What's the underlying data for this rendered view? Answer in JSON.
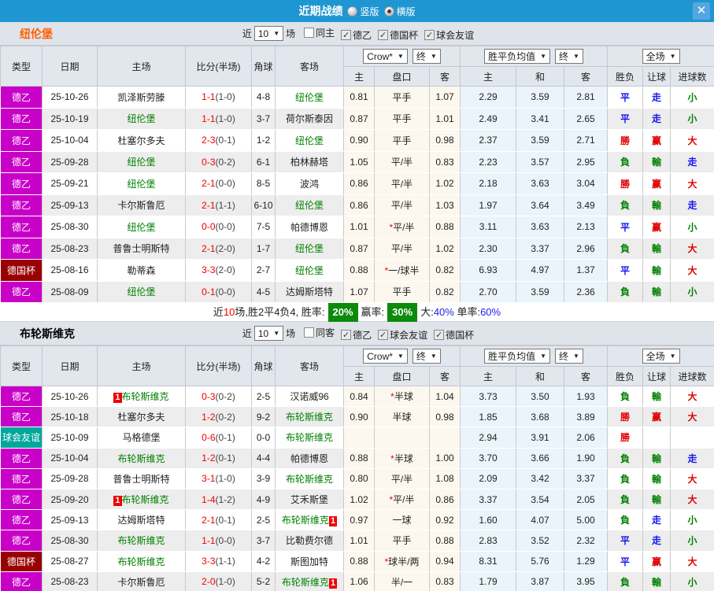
{
  "titlebar": {
    "title": "近期战绩",
    "radio_vertical": "竖版",
    "radio_horizontal": "横版",
    "close": "✕"
  },
  "table_header": {
    "type": "类型",
    "date": "日期",
    "home": "主场",
    "score": "比分(半场)",
    "corner": "角球",
    "away": "客场",
    "odds_company": "Crow*",
    "odds_final": "终",
    "avg_label": "胜平负均值",
    "avg_final": "终",
    "scope": "全场",
    "arrow": "▼",
    "sub_home": "主",
    "sub_handicap": "盘口",
    "sub_away": "客",
    "sub_avg_home": "主",
    "sub_avg_draw": "和",
    "sub_avg_away": "客",
    "sub_result": "胜负",
    "sub_let": "让球",
    "sub_goals": "进球数"
  },
  "type_colors": {
    "德乙": "#c800c8",
    "德国杯": "#990000",
    "球会友谊": "#00a79d"
  },
  "value_colors": {
    "勝": "#e00000",
    "赢": "#e00000",
    "大": "#e00000",
    "平": "#1414ee",
    "走": "#1414ee",
    "負": "#008000",
    "輸": "#008000",
    "小": "#008000"
  },
  "sections": [
    {
      "team": "纽伦堡",
      "team_color": "#ff5e00",
      "filter": {
        "near": "近",
        "count": "10",
        "games": "场",
        "checks": [
          {
            "label": "同主",
            "checked": false
          },
          {
            "label": "德乙",
            "checked": true
          },
          {
            "label": "德国杯",
            "checked": true
          },
          {
            "label": "球会友谊",
            "checked": true
          }
        ]
      },
      "rows": [
        {
          "type": "德乙",
          "date": "25-10-26",
          "home": {
            "name": "凯泽斯劳滕"
          },
          "score": "1-1",
          "half": "(1-0)",
          "corner": "4-8",
          "away": {
            "name": "纽伦堡",
            "green": true
          },
          "o1": "0.81",
          "hc": "平手",
          "o2": "1.07",
          "a1": "2.29",
          "a2": "3.59",
          "a3": "2.81",
          "r1": "平",
          "r2": "走",
          "r3": "小"
        },
        {
          "type": "德乙",
          "date": "25-10-19",
          "home": {
            "name": "纽伦堡",
            "green": true
          },
          "score": "1-1",
          "half": "(1-0)",
          "corner": "3-7",
          "away": {
            "name": "荷尔斯泰因"
          },
          "o1": "0.87",
          "hc": "平手",
          "o2": "1.01",
          "a1": "2.49",
          "a2": "3.41",
          "a3": "2.65",
          "r1": "平",
          "r2": "走",
          "r3": "小"
        },
        {
          "type": "德乙",
          "date": "25-10-04",
          "home": {
            "name": "杜塞尔多夫"
          },
          "score": "2-3",
          "half": "(0-1)",
          "corner": "1-2",
          "away": {
            "name": "纽伦堡",
            "green": true
          },
          "o1": "0.90",
          "hc": "平手",
          "o2": "0.98",
          "a1": "2.37",
          "a2": "3.59",
          "a3": "2.71",
          "r1": "勝",
          "r2": "赢",
          "r3": "大"
        },
        {
          "type": "德乙",
          "date": "25-09-28",
          "home": {
            "name": "纽伦堡",
            "green": true
          },
          "score": "0-3",
          "half": "(0-2)",
          "corner": "6-1",
          "away": {
            "name": "柏林赫塔"
          },
          "o1": "1.05",
          "hc": "平/半",
          "o2": "0.83",
          "a1": "2.23",
          "a2": "3.57",
          "a3": "2.95",
          "r1": "負",
          "r2": "輸",
          "r3": "走"
        },
        {
          "type": "德乙",
          "date": "25-09-21",
          "home": {
            "name": "纽伦堡",
            "green": true
          },
          "score": "2-1",
          "half": "(0-0)",
          "corner": "8-5",
          "away": {
            "name": "波鸿"
          },
          "o1": "0.86",
          "hc": "平/半",
          "o2": "1.02",
          "a1": "2.18",
          "a2": "3.63",
          "a3": "3.04",
          "r1": "勝",
          "r2": "赢",
          "r3": "大"
        },
        {
          "type": "德乙",
          "date": "25-09-13",
          "home": {
            "name": "卡尔斯鲁厄"
          },
          "score": "2-1",
          "half": "(1-1)",
          "corner": "6-10",
          "away": {
            "name": "纽伦堡",
            "green": true
          },
          "o1": "0.86",
          "hc": "平/半",
          "o2": "1.03",
          "a1": "1.97",
          "a2": "3.64",
          "a3": "3.49",
          "r1": "負",
          "r2": "輸",
          "r3": "走"
        },
        {
          "type": "德乙",
          "date": "25-08-30",
          "home": {
            "name": "纽伦堡",
            "green": true
          },
          "score": "0-0",
          "half": "(0-0)",
          "corner": "7-5",
          "away": {
            "name": "帕德博恩"
          },
          "o1": "1.01",
          "hc": "*平/半",
          "o2": "0.88",
          "a1": "3.11",
          "a2": "3.63",
          "a3": "2.13",
          "r1": "平",
          "r2": "赢",
          "r3": "小"
        },
        {
          "type": "德乙",
          "date": "25-08-23",
          "home": {
            "name": "普鲁士明斯特"
          },
          "score": "2-1",
          "half": "(2-0)",
          "corner": "1-7",
          "away": {
            "name": "纽伦堡",
            "green": true
          },
          "o1": "0.87",
          "hc": "平/半",
          "o2": "1.02",
          "a1": "2.30",
          "a2": "3.37",
          "a3": "2.96",
          "r1": "負",
          "r2": "輸",
          "r3": "大"
        },
        {
          "type": "德国杯",
          "date": "25-08-16",
          "home": {
            "name": "勒蒂森"
          },
          "score": "3-3",
          "half": "(2-0)",
          "corner": "2-7",
          "away": {
            "name": "纽伦堡",
            "green": true
          },
          "o1": "0.88",
          "hc": "*一/球半",
          "o2": "0.82",
          "a1": "6.93",
          "a2": "4.97",
          "a3": "1.37",
          "r1": "平",
          "r2": "輸",
          "r3": "大"
        },
        {
          "type": "德乙",
          "date": "25-08-09",
          "home": {
            "name": "纽伦堡",
            "green": true
          },
          "score": "0-1",
          "half": "(0-0)",
          "corner": "4-5",
          "away": {
            "name": "达姆斯塔特"
          },
          "o1": "1.07",
          "hc": "平手",
          "o2": "0.82",
          "a1": "2.70",
          "a2": "3.59",
          "a3": "2.36",
          "r1": "負",
          "r2": "輸",
          "r3": "小"
        }
      ],
      "summary": {
        "t1": "近",
        "count": "10",
        "t2": "场,胜2平4负4, 胜率:",
        "win_rate": "20%",
        "t3": "赢率:",
        "odds_rate": "30%",
        "t4": "大:",
        "big_rate": "40%",
        "t5": " 单率:",
        "single_rate": "60%"
      }
    },
    {
      "team": "布轮斯维克",
      "team_color": "#000000",
      "filter": {
        "near": "近",
        "count": "10",
        "games": "场",
        "checks": [
          {
            "label": "同客",
            "checked": false
          },
          {
            "label": "德乙",
            "checked": true
          },
          {
            "label": "球会友谊",
            "checked": true
          },
          {
            "label": "德国杯",
            "checked": true
          }
        ]
      },
      "rows": [
        {
          "type": "德乙",
          "date": "25-10-26",
          "home": {
            "name": "布轮斯维克",
            "green": true,
            "pre": "1"
          },
          "score": "0-3",
          "half": "(0-2)",
          "corner": "2-5",
          "away": {
            "name": "汉诺威96"
          },
          "o1": "0.84",
          "hc": "*半球",
          "o2": "1.04",
          "a1": "3.73",
          "a2": "3.50",
          "a3": "1.93",
          "r1": "負",
          "r2": "輸",
          "r3": "大"
        },
        {
          "type": "德乙",
          "date": "25-10-18",
          "home": {
            "name": "杜塞尔多夫"
          },
          "score": "1-2",
          "half": "(0-2)",
          "corner": "9-2",
          "away": {
            "name": "布轮斯维克",
            "green": true
          },
          "o1": "0.90",
          "hc": "半球",
          "o2": "0.98",
          "a1": "1.85",
          "a2": "3.68",
          "a3": "3.89",
          "r1": "勝",
          "r2": "赢",
          "r3": "大"
        },
        {
          "type": "球会友谊",
          "date": "25-10-09",
          "home": {
            "name": "马格德堡"
          },
          "score": "0-6",
          "half": "(0-1)",
          "corner": "0-0",
          "away": {
            "name": "布轮斯维克",
            "green": true
          },
          "o1": "",
          "hc": "",
          "o2": "",
          "a1": "2.94",
          "a2": "3.91",
          "a3": "2.06",
          "r1": "勝",
          "r2": "",
          "r3": ""
        },
        {
          "type": "德乙",
          "date": "25-10-04",
          "home": {
            "name": "布轮斯维克",
            "green": true
          },
          "score": "1-2",
          "half": "(0-1)",
          "corner": "4-4",
          "away": {
            "name": "帕德博恩"
          },
          "o1": "0.88",
          "hc": "*半球",
          "o2": "1.00",
          "a1": "3.70",
          "a2": "3.66",
          "a3": "1.90",
          "r1": "負",
          "r2": "輸",
          "r3": "走"
        },
        {
          "type": "德乙",
          "date": "25-09-28",
          "home": {
            "name": "普鲁士明斯特"
          },
          "score": "3-1",
          "half": "(1-0)",
          "corner": "3-9",
          "away": {
            "name": "布轮斯维克",
            "green": true
          },
          "o1": "0.80",
          "hc": "平/半",
          "o2": "1.08",
          "a1": "2.09",
          "a2": "3.42",
          "a3": "3.37",
          "r1": "負",
          "r2": "輸",
          "r3": "大"
        },
        {
          "type": "德乙",
          "date": "25-09-20",
          "home": {
            "name": "布轮斯维克",
            "green": true,
            "pre": "1"
          },
          "score": "1-4",
          "half": "(1-2)",
          "corner": "4-9",
          "away": {
            "name": "艾禾斯堡"
          },
          "o1": "1.02",
          "hc": "*平/半",
          "o2": "0.86",
          "a1": "3.37",
          "a2": "3.54",
          "a3": "2.05",
          "r1": "負",
          "r2": "輸",
          "r3": "大"
        },
        {
          "type": "德乙",
          "date": "25-09-13",
          "home": {
            "name": "达姆斯塔特"
          },
          "score": "2-1",
          "half": "(0-1)",
          "corner": "2-5",
          "away": {
            "name": "布轮斯维克",
            "green": true,
            "post": "1"
          },
          "o1": "0.97",
          "hc": "一球",
          "o2": "0.92",
          "a1": "1.60",
          "a2": "4.07",
          "a3": "5.00",
          "r1": "負",
          "r2": "走",
          "r3": "小"
        },
        {
          "type": "德乙",
          "date": "25-08-30",
          "home": {
            "name": "布轮斯维克",
            "green": true
          },
          "score": "1-1",
          "half": "(0-0)",
          "corner": "3-7",
          "away": {
            "name": "比勒费尔德"
          },
          "o1": "1.01",
          "hc": "平手",
          "o2": "0.88",
          "a1": "2.83",
          "a2": "3.52",
          "a3": "2.32",
          "r1": "平",
          "r2": "走",
          "r3": "小"
        },
        {
          "type": "德国杯",
          "date": "25-08-27",
          "home": {
            "name": "布轮斯维克",
            "green": true
          },
          "score": "3-3",
          "half": "(1-1)",
          "corner": "4-2",
          "away": {
            "name": "斯图加特"
          },
          "o1": "0.88",
          "hc": "*球半/两",
          "o2": "0.94",
          "a1": "8.31",
          "a2": "5.76",
          "a3": "1.29",
          "r1": "平",
          "r2": "赢",
          "r3": "大"
        },
        {
          "type": "德乙",
          "date": "25-08-23",
          "home": {
            "name": "卡尔斯鲁厄"
          },
          "score": "2-0",
          "half": "(1-0)",
          "corner": "5-2",
          "away": {
            "name": "布轮斯维克",
            "green": true,
            "post": "1"
          },
          "o1": "1.06",
          "hc": "半/一",
          "o2": "0.83",
          "a1": "1.79",
          "a2": "3.87",
          "a3": "3.95",
          "r1": "負",
          "r2": "輸",
          "r3": "小"
        }
      ],
      "summary": null
    }
  ]
}
